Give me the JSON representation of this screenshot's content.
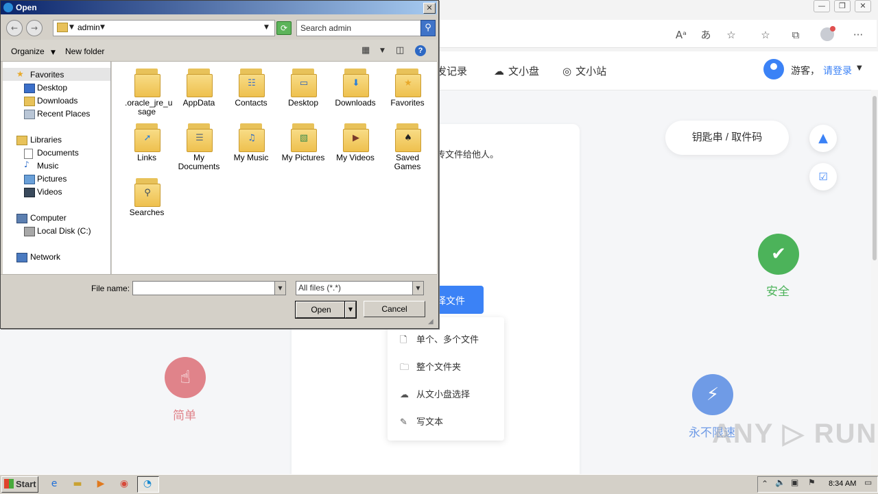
{
  "browser": {
    "window_controls": [
      "—",
      "❐",
      "✕"
    ],
    "toolbar_icons": [
      "read-aloud-icon",
      "translate-icon",
      "add-favorite-icon",
      "favorites-icon",
      "collections-icon",
      "profile-icon",
      "more-icon"
    ],
    "toolbar_glyphs": {
      "read_aloud": "Aᵃ",
      "translate": "あ",
      "add_fav": "☆",
      "favs": "☆",
      "collections": "⧉",
      "more": "···"
    }
  },
  "site": {
    "nav": [
      {
        "label": "发记录",
        "icon": ""
      },
      {
        "label": "文小盘",
        "icon": "☁"
      },
      {
        "label": "文小站",
        "icon": "◎"
      }
    ],
    "user": {
      "guest": "游客，",
      "login": "请登录",
      "caret": "▼"
    },
    "card_desc": "传文件给他人。",
    "upload_button": "择文件",
    "upload_menu": [
      {
        "label": "单个、多个文件",
        "icon": "🗋"
      },
      {
        "label": "整个文件夹",
        "icon": "🗀"
      },
      {
        "label": "从文小盘选择",
        "icon": "☁"
      },
      {
        "label": "写文本",
        "icon": "✎"
      }
    ],
    "key_pill": "钥匙串 / 取件码",
    "side_icons": [
      "image-icon",
      "calendar-check-icon"
    ],
    "features": [
      {
        "label": "安全",
        "icon": "✔",
        "color": "#4cb35a"
      },
      {
        "label": "简单",
        "icon": "☝",
        "color": "#e0838a"
      },
      {
        "label": "永不限速",
        "icon": "⚡",
        "color": "#6f9be6"
      }
    ],
    "watermark": "ANY ▷ RUN"
  },
  "dialog": {
    "title": "Open",
    "close": "✕",
    "path": "admin",
    "search_placeholder": "Search admin",
    "toolbar": {
      "organize": "Organize",
      "new_folder": "New folder"
    },
    "nav_pane": {
      "favorites": {
        "label": "Favorites",
        "items": [
          "Desktop",
          "Downloads",
          "Recent Places"
        ]
      },
      "libraries": {
        "label": "Libraries",
        "items": [
          "Documents",
          "Music",
          "Pictures",
          "Videos"
        ]
      },
      "computer": {
        "label": "Computer",
        "items": [
          "Local Disk (C:)"
        ]
      },
      "network": {
        "label": "Network"
      }
    },
    "files": [
      {
        "name": ".oracle_jre_usage",
        "line1": ".oracle_jre_u",
        "line2": "sage",
        "emblem": ""
      },
      {
        "name": "AppData",
        "line1": "AppData",
        "line2": "",
        "emblem": ""
      },
      {
        "name": "Contacts",
        "line1": "Contacts",
        "line2": "",
        "emblem": "☷"
      },
      {
        "name": "Desktop",
        "line1": "Desktop",
        "line2": "",
        "emblem": "▭"
      },
      {
        "name": "Downloads",
        "line1": "Downloads",
        "line2": "",
        "emblem": "⬇"
      },
      {
        "name": "Favorites",
        "line1": "Favorites",
        "line2": "",
        "emblem": "★"
      },
      {
        "name": "Links",
        "line1": "Links",
        "line2": "",
        "emblem": "➚"
      },
      {
        "name": "My Documents",
        "line1": "My",
        "line2": "Documents",
        "emblem": "☰"
      },
      {
        "name": "My Music",
        "line1": "My Music",
        "line2": "",
        "emblem": "♫"
      },
      {
        "name": "My Pictures",
        "line1": "My Pictures",
        "line2": "",
        "emblem": "▧"
      },
      {
        "name": "My Videos",
        "line1": "My Videos",
        "line2": "",
        "emblem": "▶"
      },
      {
        "name": "Saved Games",
        "line1": "Saved",
        "line2": "Games",
        "emblem": "♠"
      },
      {
        "name": "Searches",
        "line1": "Searches",
        "line2": "",
        "emblem": "⚲"
      }
    ],
    "file_name_label": "File name:",
    "file_name_value": "",
    "filter": "All files (*.*)",
    "open_button": "Open",
    "cancel_button": "Cancel"
  },
  "taskbar": {
    "start": "Start",
    "clock": "8:34 AM",
    "quick_launch": [
      "internet-explorer-icon",
      "explorer-icon",
      "media-player-icon",
      "chrome-icon",
      "edge-icon"
    ]
  }
}
